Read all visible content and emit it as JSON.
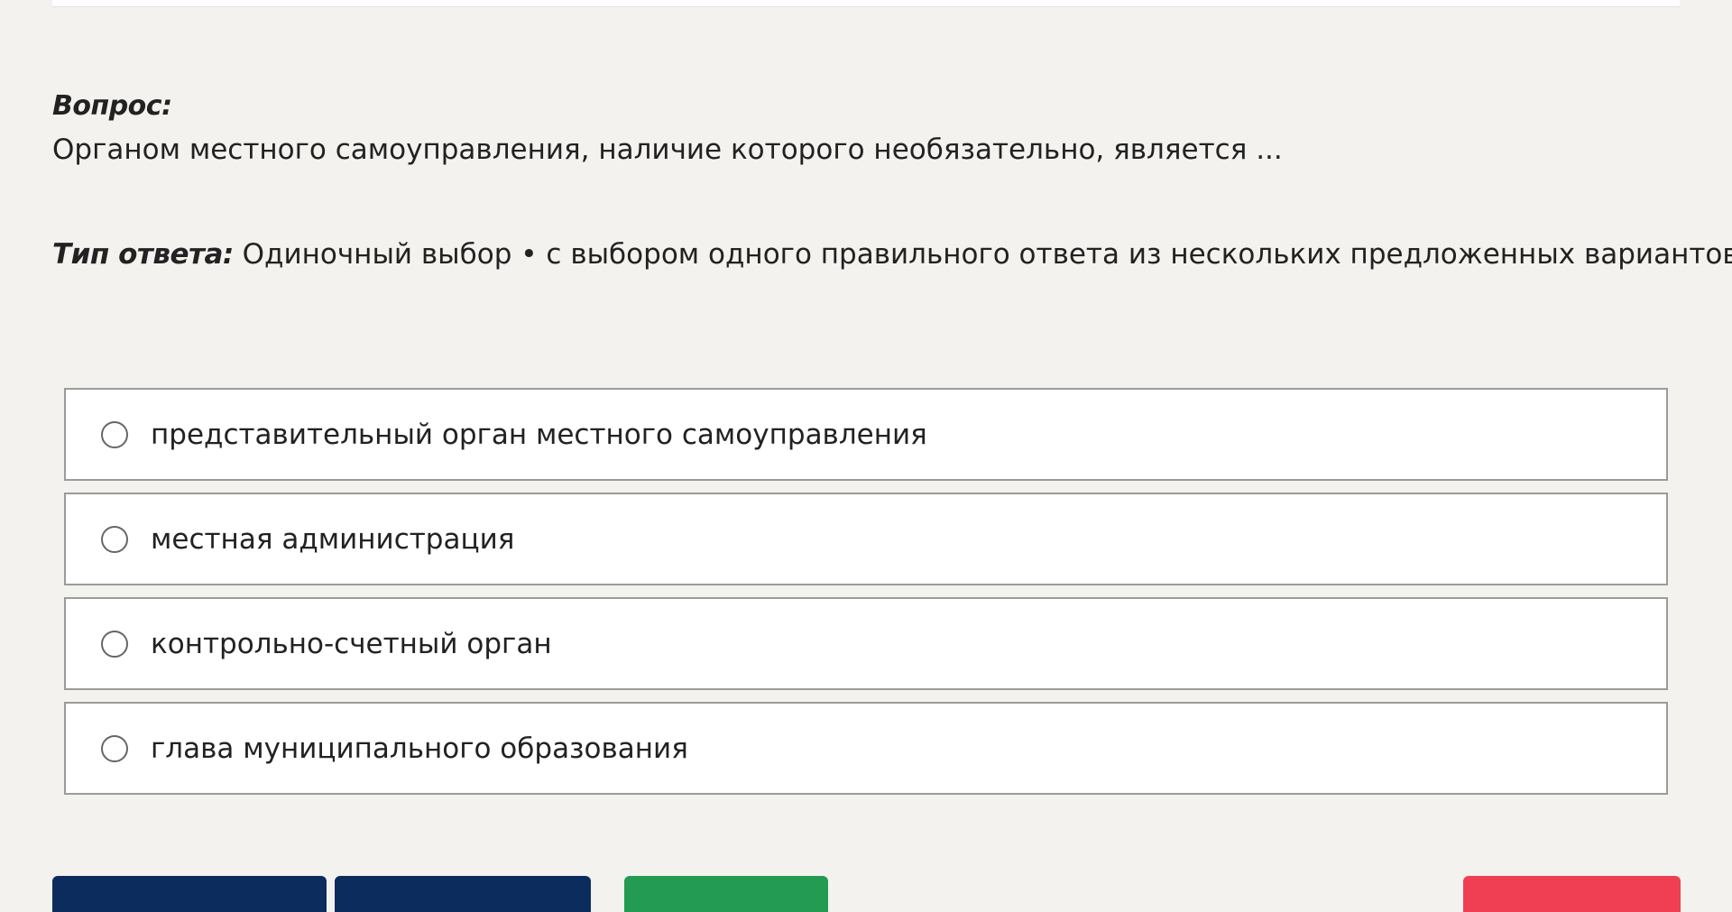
{
  "question": {
    "label": "Вопрос:",
    "text": "Органом местного самоуправления, наличие которого необязательно, является ..."
  },
  "answer_type": {
    "label": "Тип ответа:",
    "value": "Одиночный выбор • с выбором одного правильного ответа из нескольких предложенных вариантов"
  },
  "options": [
    {
      "label": "представительный орган местного самоуправления",
      "selected": false
    },
    {
      "label": "местная администрация",
      "selected": false
    },
    {
      "label": "контрольно-счетный орган",
      "selected": false
    },
    {
      "label": "глава муниципального образования",
      "selected": false
    }
  ],
  "colors": {
    "page_background": "#f3f2ef",
    "nav_button": "#0c2c5e",
    "answer_button": "#239b52",
    "finish_button": "#f03f52",
    "option_border": "#9b9b9b"
  }
}
